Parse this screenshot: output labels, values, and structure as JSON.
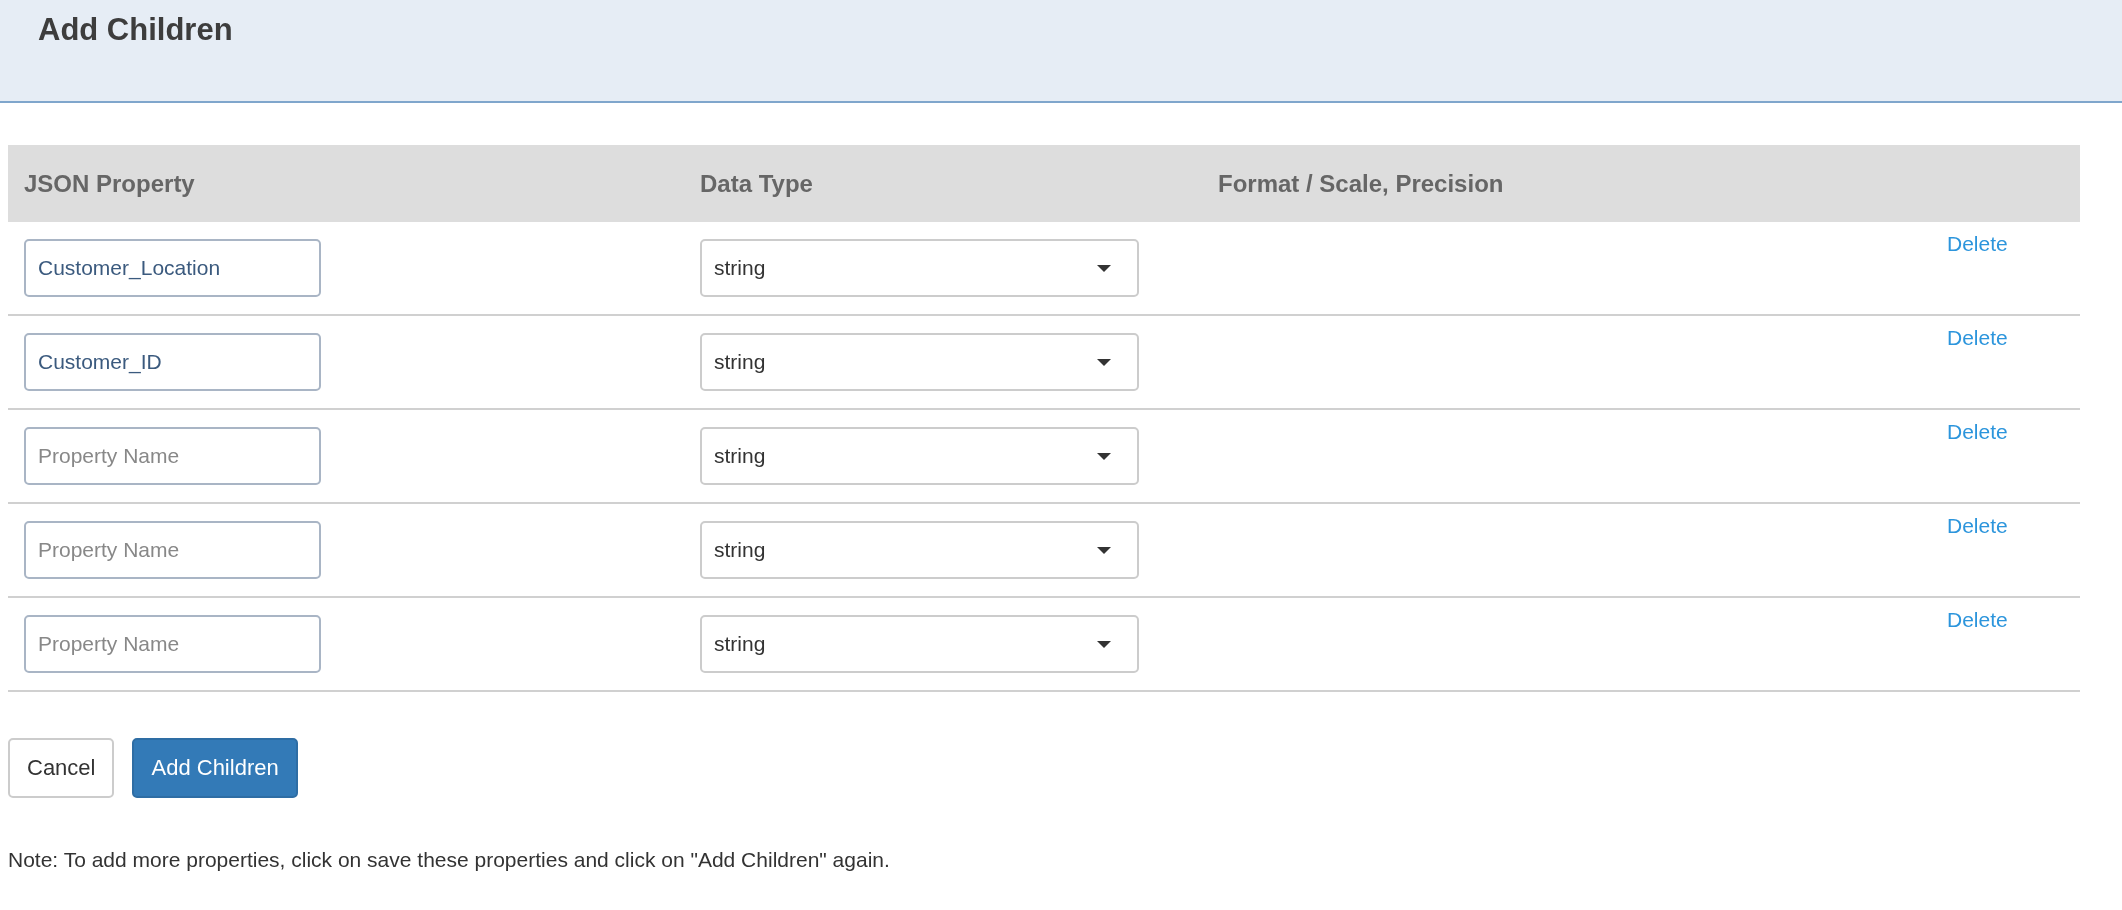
{
  "header": {
    "title": "Add Children"
  },
  "table": {
    "columns": [
      "JSON Property",
      "Data Type",
      "Format / Scale, Precision"
    ],
    "rows": [
      {
        "property": {
          "value": "Customer_Location"
        },
        "data_type": "string",
        "action": "Delete"
      },
      {
        "property": {
          "value": "Customer_ID"
        },
        "data_type": "string",
        "action": "Delete"
      },
      {
        "property": {
          "placeholder": "Property Name"
        },
        "data_type": "string",
        "action": "Delete"
      },
      {
        "property": {
          "placeholder": "Property Name"
        },
        "data_type": "string",
        "action": "Delete"
      },
      {
        "property": {
          "placeholder": "Property Name"
        },
        "data_type": "string",
        "action": "Delete"
      }
    ]
  },
  "buttons": [
    {
      "label": "Cancel",
      "kind": "default"
    },
    {
      "label": "Add Children",
      "kind": "primary"
    }
  ],
  "note": "Note: To add more properties, click on save these properties and click on \"Add Children\" again."
}
